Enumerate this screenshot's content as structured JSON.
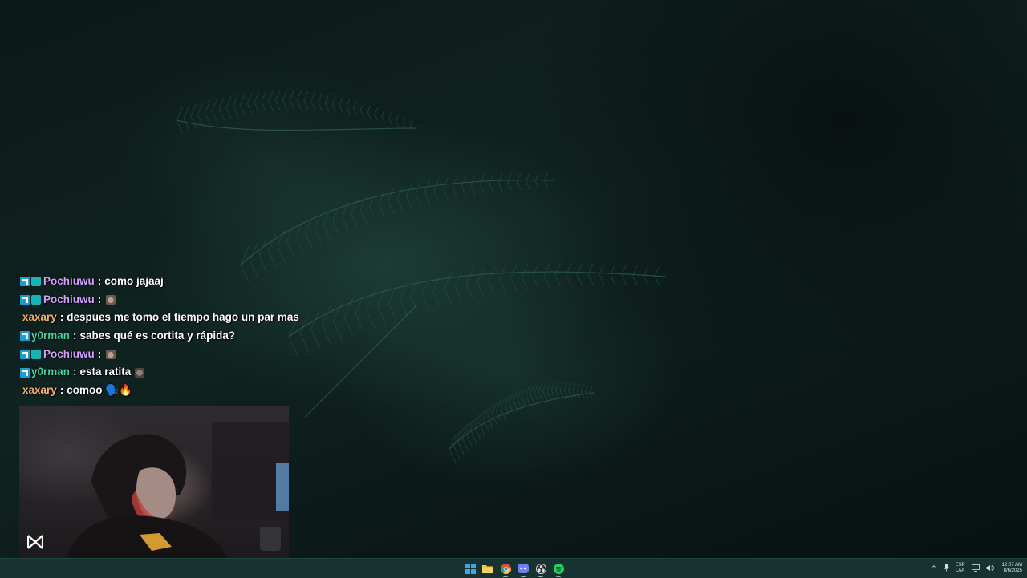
{
  "chat": {
    "messages": [
      {
        "badges": [
          "prime",
          "sub"
        ],
        "user": "Pochiuwu",
        "user_color": "#d2a0ff",
        "text": "como jajaaj",
        "emote": null
      },
      {
        "badges": [
          "prime",
          "sub"
        ],
        "user": "Pochiuwu",
        "user_color": "#d2a0ff",
        "text": "",
        "emote": "cat-emote"
      },
      {
        "badges": [],
        "user": "xaxary",
        "user_color": "#f2b46a",
        "text": "despues me tomo el tiempo hago un par mas",
        "emote": null
      },
      {
        "badges": [
          "prime"
        ],
        "user": "y0rman",
        "user_color": "#3fd3a6",
        "text": "sabes qué es cortita y rápida?",
        "emote": null
      },
      {
        "badges": [
          "prime",
          "sub"
        ],
        "user": "Pochiuwu",
        "user_color": "#d2a0ff",
        "text": "",
        "emote": "cat-emote"
      },
      {
        "badges": [
          "prime"
        ],
        "user": "y0rman",
        "user_color": "#3fd3a6",
        "text": "esta ratita",
        "emote": "rat-emote"
      },
      {
        "badges": [],
        "user": "xaxary",
        "user_color": "#f2b46a",
        "text": "comoo 🗣️🔥",
        "emote": null
      }
    ],
    "separator": ":"
  },
  "webcam": {
    "logo_icon": "streamer-logo-icon"
  },
  "taskbar": {
    "apps": [
      {
        "name": "start-icon",
        "color": "#3aa6f0"
      },
      {
        "name": "file-explorer-icon",
        "color": "#f4c542"
      },
      {
        "name": "chrome-icon",
        "color": "#e04b3a",
        "active": true
      },
      {
        "name": "discord-icon",
        "color": "#6f7df2",
        "active": true
      },
      {
        "name": "obs-icon",
        "color": "#dcdcdc",
        "active": true
      },
      {
        "name": "spotify-icon",
        "color": "#1ed760",
        "active": true
      }
    ],
    "tray": {
      "lang_line1": "ESP",
      "lang_line2": "LAA",
      "time": "12:07 AM",
      "date": "8/6/2025"
    }
  },
  "colors": {
    "taskbar_bg": "#163332",
    "badge_prime": "#1e9ad6",
    "badge_sub": "#19b3b3"
  }
}
